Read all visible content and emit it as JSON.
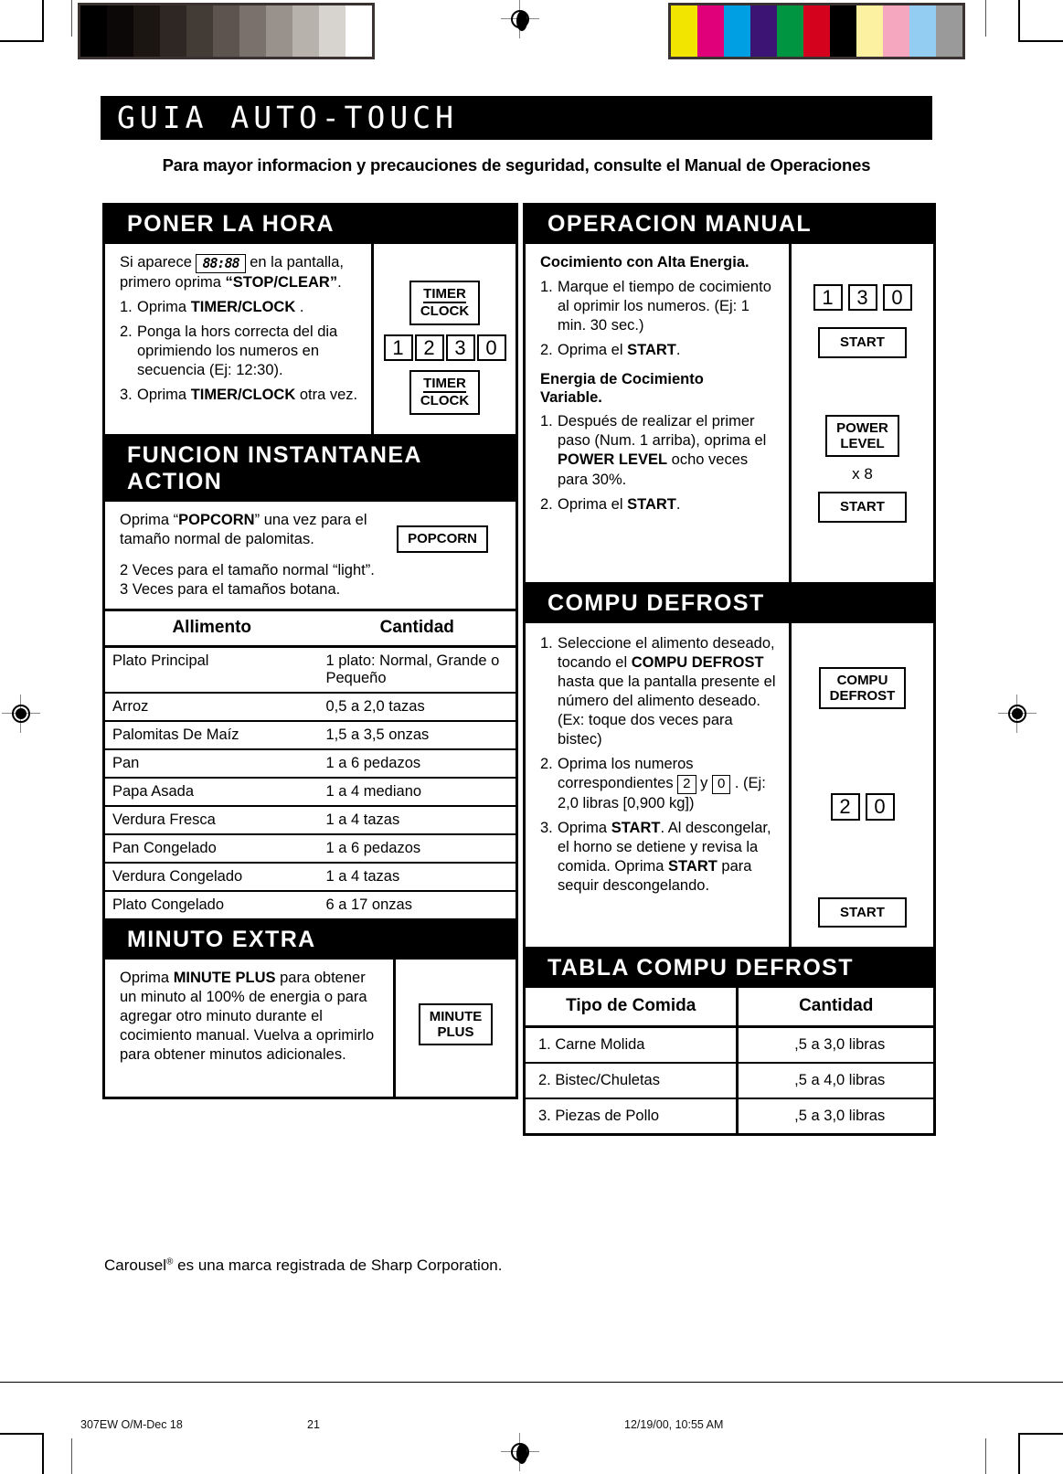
{
  "document": {
    "banner_title": "GUIA AUTO-TOUCH",
    "subtitle": "Para mayor informacion y precauciones de seguridad, consulte el Manual de Operaciones",
    "trademark": "es una marca registrada de Sharp Corporation.",
    "trademark_brand": "Carousel",
    "trademark_symbol": "®"
  },
  "poner_la_hora": {
    "heading": "PONER LA HORA",
    "intro_a": "Si aparece",
    "lcd": "88:88",
    "intro_b": "en la pantalla, primero oprima",
    "intro_c": "STOP/CLEAR",
    "intro_d": ".",
    "steps": [
      {
        "num": "1.",
        "text": "Oprima TIMER/CLOCK ."
      },
      {
        "num": "2.",
        "text": "Ponga la hors correcta del dia oprimiendo los numeros en secuencia (Ej: 12:30)."
      },
      {
        "num": "3.",
        "text": "Oprima TIMER/CLOCK otra vez."
      }
    ],
    "keys": {
      "timer_clock_top_line1": "TIMER",
      "timer_clock_top_line2": "CLOCK",
      "numbers": [
        "1",
        "2",
        "3",
        "0"
      ],
      "timer_clock_bottom_line1": "TIMER",
      "timer_clock_bottom_line2": "CLOCK"
    }
  },
  "funcion_instantanea": {
    "heading_line1": "FUNCION INSTANTANEA",
    "heading_line2": "ACTION",
    "paragraph1": "Oprima “POPCORN” una vez para el tamaño normal de palomitas.",
    "paragraph1_bold": "POPCORN",
    "paragraph2_line1": "2 Veces para el tamaño normal “light”.",
    "paragraph2_line2": "3 Veces para el tamaños botana.",
    "key_popcorn": "POPCORN"
  },
  "alimento_table": {
    "headers": [
      "Allimento",
      "Cantidad"
    ],
    "rows": [
      [
        "Plato Principal",
        "1 plato: Normal, Grande o Pequeño"
      ],
      [
        "Arroz",
        "0,5 a 2,0 tazas"
      ],
      [
        "Palomitas De Maíz",
        "1,5 a 3,5 onzas"
      ],
      [
        "Pan",
        "1 a 6 pedazos"
      ],
      [
        "Papa Asada",
        "1 a 4 mediano"
      ],
      [
        "Verdura Fresca",
        "1 a 4 tazas"
      ],
      [
        "Pan Congelado",
        "1 a 6 pedazos"
      ],
      [
        "Verdura Congelado",
        "1 a 4 tazas"
      ],
      [
        "Plato Congelado",
        "6 a 17 onzas"
      ]
    ]
  },
  "minuto_extra": {
    "heading": "MINUTO EXTRA",
    "paragraph": "Oprima MINUTE PLUS para obtener un minuto al 100% de energia o para agregar otro minuto durante el cocimiento manual. Vuelva a oprimirlo para obtener minutos adicionales.",
    "paragraph_bold": "MINUTE PLUS",
    "key_line1": "MINUTE",
    "key_line2": "PLUS"
  },
  "operacion_manual": {
    "heading": "OPERACION MANUAL",
    "sub1": "Cocimiento con Alta Energia.",
    "steps1": [
      {
        "num": "1.",
        "text": "Marque el tiempo de cocimiento al oprimir los numeros. (Ej: 1 min. 30 sec.)"
      },
      {
        "num": "2.",
        "text": "Oprima el START."
      }
    ],
    "sub2_line1": "Energia de Cocimiento",
    "sub2_line2": "Variable.",
    "steps2": [
      {
        "num": "1.",
        "text": "Después de realizar el primer paso (Num. 1 arriba), oprima el POWER LEVEL ocho veces para 30%."
      },
      {
        "num": "2.",
        "text": "Oprima el START."
      }
    ],
    "keys": {
      "numbers": [
        "1",
        "3",
        "0"
      ],
      "start1": "START",
      "power_level_line1": "POWER",
      "power_level_line2": "LEVEL",
      "multiplier": "x 8",
      "start2": "START"
    }
  },
  "compu_defrost": {
    "heading": "COMPU DEFROST",
    "steps": [
      {
        "num": "1.",
        "text": "Seleccione el alimento deseado, tocando el COMPU DEFROST hasta que la pantalla presente el número del alimento deseado. (Ex: toque dos veces para bistec)"
      },
      {
        "num": "2.",
        "text": "Oprima los numeros correspondientes 2 y 0 . (Ej: 2,0 libras [0,900 kg])"
      },
      {
        "num": "3.",
        "text": "Oprima START. Al descongelar, el horno se detiene y revisa la comida. Oprima START para sequir descongelando."
      }
    ],
    "inline_keys": [
      "2",
      "0"
    ],
    "keys": {
      "compu_defrost_line1": "COMPU",
      "compu_defrost_line2": "DEFROST",
      "numbers": [
        "2",
        "0"
      ],
      "start": "START"
    }
  },
  "tabla_compu_defrost": {
    "heading": "TABLA COMPU DEFROST",
    "headers": [
      "Tipo de Comida",
      "Cantidad"
    ],
    "rows": [
      [
        "1. Carne Molida",
        ",5 a 3,0 libras"
      ],
      [
        "2. Bistec/Chuletas",
        ",5 a 4,0 libras"
      ],
      [
        "3. Piezas de Pollo",
        ",5 a 3,0 libras"
      ]
    ]
  },
  "print_footer": {
    "left": "307EW O/M-Dec 18",
    "center": "21",
    "right": "12/19/00, 10:55 AM"
  },
  "color_bars": {
    "gray_scale": [
      "#000000",
      "#0c0808",
      "#1c1613",
      "#2e2724",
      "#433b36",
      "#5d5450",
      "#7a716c",
      "#99918c",
      "#b8b2ad",
      "#d7d3cf",
      "#ffffff"
    ],
    "colors": [
      "#f2e500",
      "#e0007a",
      "#009ee3",
      "#3b1474",
      "#009540",
      "#d4021d",
      "#000000",
      "#fbf1a0",
      "#f4a7bf",
      "#94cdf2",
      "#9a9a9a"
    ]
  }
}
